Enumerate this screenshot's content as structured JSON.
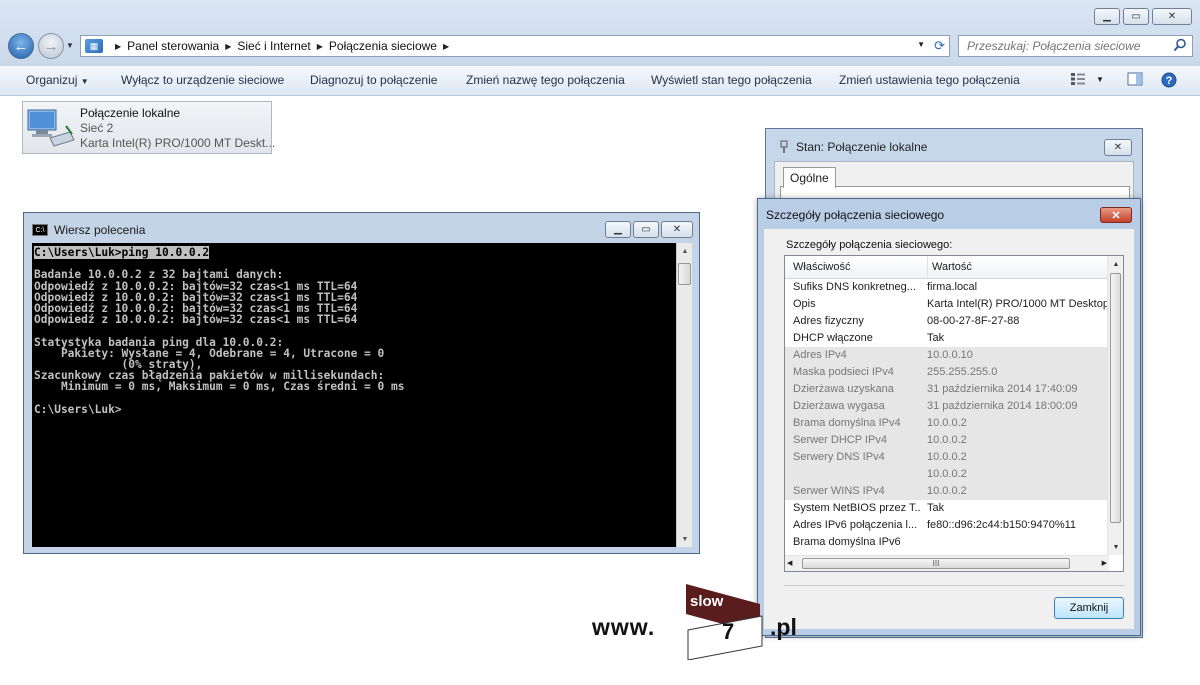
{
  "explorer": {
    "breadcrumbs": [
      "Panel sterowania",
      "Sieć i Internet",
      "Połączenia sieciowe"
    ],
    "search_placeholder": "Przeszukaj: Połączenia sieciowe",
    "toolbar": {
      "organize": "Organizuj",
      "disable": "Wyłącz to urządzenie sieciowe",
      "diagnose": "Diagnozuj to połączenie",
      "rename": "Zmień nazwę tego połączenia",
      "view_status": "Wyświetl stan tego połączenia",
      "change_settings": "Zmień ustawienia tego połączenia"
    },
    "connection": {
      "name": "Połączenie lokalne",
      "network": "Sieć 2",
      "adapter": "Karta Intel(R) PRO/1000 MT Deskt..."
    }
  },
  "cmd": {
    "title": "Wiersz polecenia",
    "lines": [
      "C:\\Users\\Luk>ping 10.0.0.2",
      "",
      "Badanie 10.0.0.2 z 32 bajtami danych:",
      "Odpowiedź z 10.0.0.2: bajtów=32 czas<1 ms TTL=64",
      "Odpowiedź z 10.0.0.2: bajtów=32 czas<1 ms TTL=64",
      "Odpowiedź z 10.0.0.2: bajtów=32 czas<1 ms TTL=64",
      "Odpowiedź z 10.0.0.2: bajtów=32 czas<1 ms TTL=64",
      "",
      "Statystyka badania ping dla 10.0.0.2:",
      "    Pakiety: Wysłane = 4, Odebrane = 4, Utracone = 0",
      "             (0% straty),",
      "Szacunkowy czas błądzenia pakietów w millisekundach:",
      "    Minimum = 0 ms, Maksimum = 0 ms, Czas średni = 0 ms",
      "",
      "C:\\Users\\Luk>"
    ]
  },
  "status_window": {
    "title": "Stan: Połączenie lokalne",
    "tab": "Ogólne"
  },
  "details": {
    "title": "Szczegóły połączenia sieciowego",
    "label": "Szczegóły połączenia sieciowego:",
    "col_property": "Właściwość",
    "col_value": "Wartość",
    "rows": [
      {
        "property": "Sufiks DNS konkretneg...",
        "value": "firma.local",
        "grey": false
      },
      {
        "property": "Opis",
        "value": "Karta Intel(R) PRO/1000 MT Desktop",
        "grey": false
      },
      {
        "property": "Adres fizyczny",
        "value": "08-00-27-8F-27-88",
        "grey": false
      },
      {
        "property": "DHCP włączone",
        "value": "Tak",
        "grey": false
      },
      {
        "property": "Adres IPv4",
        "value": "10.0.0.10",
        "grey": true
      },
      {
        "property": "Maska podsieci IPv4",
        "value": "255.255.255.0",
        "grey": true
      },
      {
        "property": "Dzierżawa uzyskana",
        "value": "31 października 2014 17:40:09",
        "grey": true
      },
      {
        "property": "Dzierżawa wygasa",
        "value": "31 października 2014 18:00:09",
        "grey": true
      },
      {
        "property": "Brama domyślna IPv4",
        "value": "10.0.0.2",
        "grey": true
      },
      {
        "property": "Serwer DHCP IPv4",
        "value": "10.0.0.2",
        "grey": true
      },
      {
        "property": "Serwery DNS IPv4",
        "value": "10.0.0.2",
        "grey": true
      },
      {
        "property": "",
        "value": "10.0.0.2",
        "grey": true
      },
      {
        "property": "Serwer WINS IPv4",
        "value": "10.0.0.2",
        "grey": true
      },
      {
        "property": "System NetBIOS przez T...",
        "value": "Tak",
        "grey": false
      },
      {
        "property": "Adres IPv6 połączenia l...",
        "value": "fe80::d96:2c44:b150:9470%11",
        "grey": false
      },
      {
        "property": "Brama domyślna IPv6",
        "value": "",
        "grey": false
      }
    ],
    "close_button": "Zamknij"
  },
  "watermark": {
    "prefix": "www.",
    "badge_top": "slow",
    "badge_num": "7",
    "suffix": ".pl"
  }
}
